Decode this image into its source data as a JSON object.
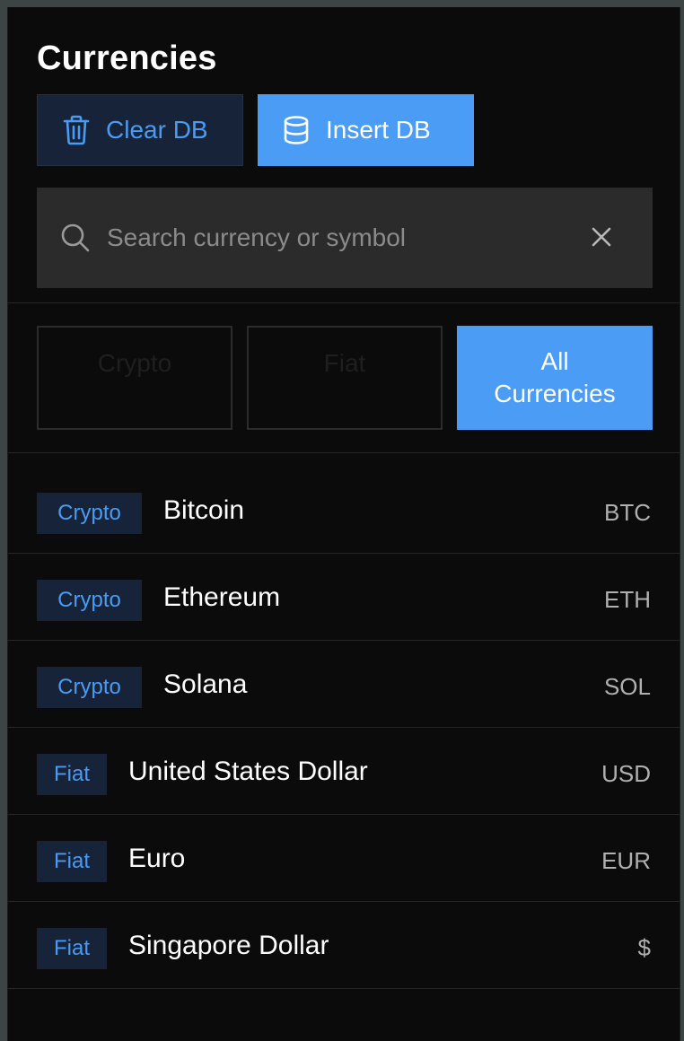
{
  "header": {
    "title": "Currencies"
  },
  "actions": {
    "clear_label": "Clear DB",
    "insert_label": "Insert DB",
    "clear_icon": "trash-icon",
    "insert_icon": "database-icon"
  },
  "search": {
    "placeholder": "Search currency or symbol",
    "value": "",
    "icon": "search-icon",
    "clear_icon": "close-icon"
  },
  "filters": [
    {
      "label": "Crypto",
      "active": false
    },
    {
      "label": "Fiat",
      "active": false
    },
    {
      "label": "All Currencies",
      "active": true
    }
  ],
  "currencies": [
    {
      "type": "Crypto",
      "name": "Bitcoin",
      "symbol": "BTC"
    },
    {
      "type": "Crypto",
      "name": "Ethereum",
      "symbol": "ETH"
    },
    {
      "type": "Crypto",
      "name": "Solana",
      "symbol": "SOL"
    },
    {
      "type": "Fiat",
      "name": "United States Dollar",
      "symbol": "USD"
    },
    {
      "type": "Fiat",
      "name": "Euro",
      "symbol": "EUR"
    },
    {
      "type": "Fiat",
      "name": "Singapore Dollar",
      "symbol": "$"
    }
  ],
  "colors": {
    "accent": "#4b9cf5",
    "badge_bg": "#162338",
    "panel_bg": "#0b0b0b",
    "search_bg": "#2b2b2b"
  }
}
